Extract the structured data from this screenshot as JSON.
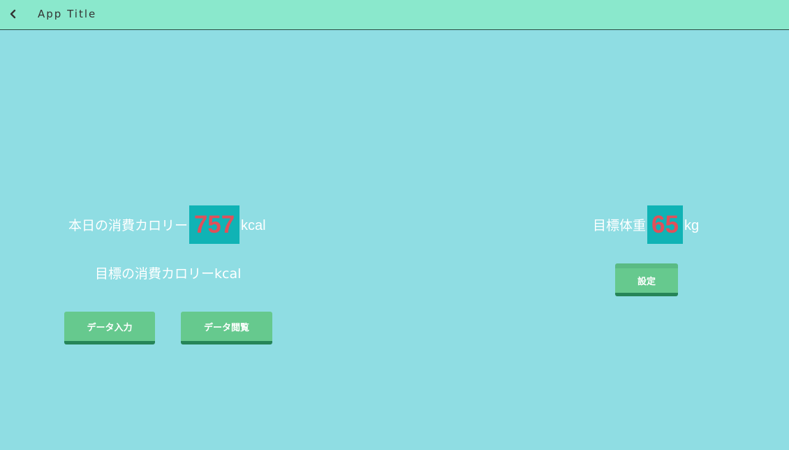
{
  "header": {
    "back_icon": "chevron-left-icon",
    "title": "App Title"
  },
  "calories": {
    "label": "本日の消費カロリー",
    "value": "757",
    "unit": "kcal"
  },
  "goal_calories": {
    "label": "目標の消費カロリーkcal"
  },
  "goal_weight": {
    "label": "目標体重",
    "value": "65",
    "unit": "kg"
  },
  "buttons": {
    "data_input": "データ入力",
    "data_view": "データ閲覧",
    "settings": "設定"
  },
  "colors": {
    "background": "#8fdde3",
    "header": "#8ae8cc",
    "highlight_bg": "#10b3b5",
    "highlight_text": "#e0505a",
    "button": "#66c98e",
    "button_shadow": "#268558"
  }
}
